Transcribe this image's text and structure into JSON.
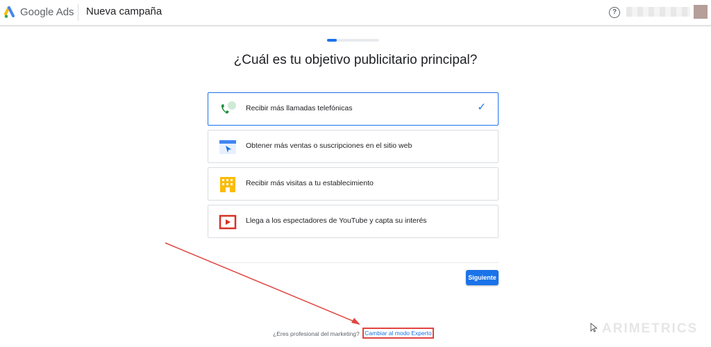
{
  "header": {
    "brand": "Google Ads",
    "page_title": "Nueva campaña",
    "help_icon": "?"
  },
  "progress": {
    "fraction": 0.18
  },
  "question": "¿Cuál es tu objetivo publicitario principal?",
  "options": [
    {
      "label": "Recibir más llamadas telefónicas",
      "icon": "phone-icon",
      "selected": true
    },
    {
      "label": "Obtener más ventas o suscripciones en el sitio web",
      "icon": "browser-window-icon",
      "selected": false
    },
    {
      "label": "Recibir más visitas a tu establecimiento",
      "icon": "building-icon",
      "selected": false
    },
    {
      "label": "Llega a los espectadores de YouTube y capta su interés",
      "icon": "video-play-icon",
      "selected": false
    }
  ],
  "check_mark": "✓",
  "next_button": "Siguiente",
  "footer": {
    "pro_text": "¿Eres profesional del marketing?",
    "expert_link": "Cambiar al modo Experto"
  },
  "watermark": "ARIMETRICS",
  "colors": {
    "accent": "#1a73e8",
    "annotation": "#e0453f"
  }
}
